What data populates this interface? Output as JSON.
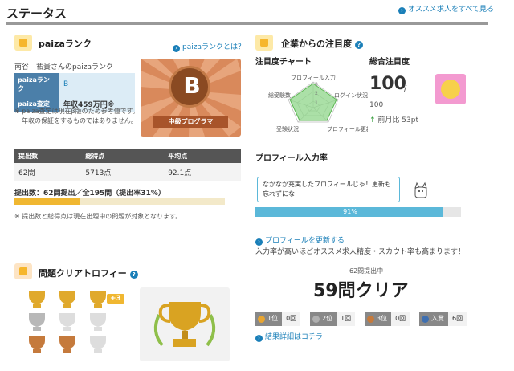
{
  "header": {
    "title": "ステータス",
    "recommend_link": "オススメ求人をすべて見る"
  },
  "paiza_rank": {
    "title": "paizaランク",
    "help_link": "paizaランクとは？",
    "user_line": "南谷　祐貴さんのpaizaランク",
    "rank_label": "paizaランク",
    "rank_value": "B",
    "estimate_label": "paiza査定",
    "estimate_value": "年収459万円※",
    "note1": "※ paiza査定は現在β版のため参考値です。",
    "note2": "年収の保証をするものではありません。",
    "badge_letter": "B",
    "badge_caption": "中級プログラマ"
  },
  "stats": {
    "headers": [
      "提出数",
      "総得点",
      "平均点"
    ],
    "values": [
      "62問",
      "5713点",
      "92.1点"
    ],
    "submission_text": "提出数：62問提出／全195問（提出率31%）",
    "submission_rate": 0.31,
    "note": "※ 提出数と総得点は現在出題中の問題が対象となります。"
  },
  "trophy": {
    "title": "問題クリアトロフィー",
    "extra_badge": "+3",
    "cleared_caption": "62問提出中",
    "cleared_big": "59問クリア",
    "places": [
      {
        "label": "1位",
        "count": "0回",
        "color": "#e8a531"
      },
      {
        "label": "2位",
        "count": "1回",
        "color": "#b0b0b0"
      },
      {
        "label": "3位",
        "count": "0回",
        "color": "#c57a3c"
      },
      {
        "label": "入賞",
        "count": "6回",
        "color": "#3e6fb0"
      }
    ],
    "result_link": "結果詳細はコチラ"
  },
  "attention": {
    "title": "企業からの注目度",
    "chart_title": "注目度チャート",
    "total_title": "総合注目度",
    "radar_labels": [
      "プロフィール入力",
      "ログイン状況",
      "プロフィール更新",
      "受験状況",
      "総受験数"
    ],
    "radar_ticks": [
      "1",
      "2",
      "3"
    ],
    "total_value": "100",
    "total_max": "100",
    "slash": "/",
    "prev_month": "前月比 53pt"
  },
  "profile": {
    "title": "プロフィール入力率",
    "speech": "なかなか充実したプロフィールじゃ！更新も忘れずにな",
    "rate_text": "91%",
    "rate": 0.91,
    "update_link": "プロフィールを更新する",
    "note": "入力率が高いほどオススメ求人精度・スカウト率も高まります！"
  },
  "colors": {
    "accent_blue": "#1a7fb8",
    "rank_bg": "#dcecf6",
    "bar_gold": "#f0b731",
    "bar_teal": "#5bb8d9",
    "radar_green": "#8fd68a"
  }
}
